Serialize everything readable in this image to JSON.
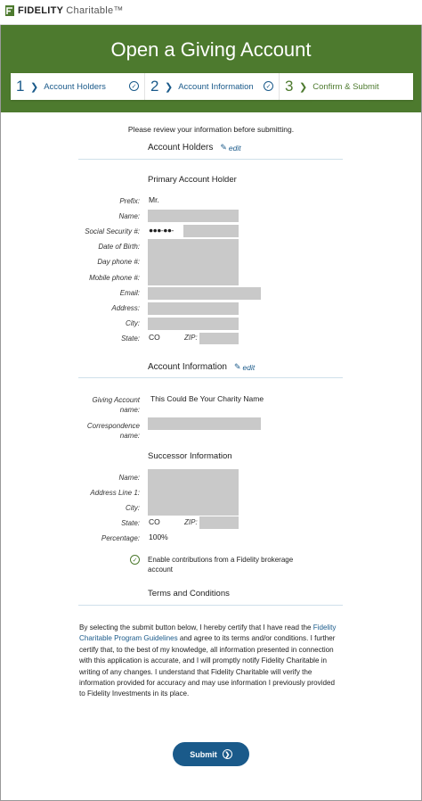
{
  "brand": {
    "name_bold": "FIDELITY",
    "name_rest": "Charitable™"
  },
  "page": {
    "title": "Open a Giving Account"
  },
  "steps": [
    {
      "num": "1",
      "label": "Account Holders",
      "complete": true
    },
    {
      "num": "2",
      "label": "Account Information",
      "complete": true
    },
    {
      "num": "3",
      "label": "Confirm & Submit",
      "complete": false
    }
  ],
  "review_note": "Please review your information before submitting.",
  "account_holders": {
    "heading": "Account Holders",
    "edit_label": "edit",
    "primary_heading": "Primary Account Holder",
    "labels": {
      "prefix": "Prefix:",
      "name": "Name:",
      "ssn": "Social Security #:",
      "dob": "Date of Birth:",
      "day_phone": "Day phone #:",
      "mobile_phone": "Mobile phone #:",
      "email": "Email:",
      "address": "Address:",
      "city": "City:",
      "state": "State:",
      "zip": "ZIP:"
    },
    "values": {
      "prefix": "Mr.",
      "ssn_mask": "●●●-●●-",
      "state": "CO"
    }
  },
  "account_information": {
    "heading": "Account Information",
    "edit_label": "edit",
    "labels": {
      "giving_name_1": "Giving Account",
      "giving_name_2": "name:",
      "correspondence_1": "Correspondence",
      "correspondence_2": "name:"
    },
    "values": {
      "giving_name": "This Could Be Your Charity Name"
    }
  },
  "successor": {
    "heading": "Successor Information",
    "labels": {
      "name": "Name:",
      "address1": "Address Line 1:",
      "city": "City:",
      "state": "State:",
      "zip": "ZIP:",
      "percentage": "Percentage:"
    },
    "values": {
      "state": "CO",
      "percentage": "100%"
    }
  },
  "brokerage_option": {
    "text": "Enable contributions from a Fidelity brokerage account",
    "checked": true
  },
  "terms": {
    "heading": "Terms and Conditions",
    "intro": "By selecting the submit button below, I hereby certify that I have read the ",
    "link": "Fidelity Charitable Program Guidelines",
    "rest": " and agree to its terms and/or conditions. I further certify that, to the best of my knowledge, all information presented in connection with this application is accurate, and I will promptly notify Fidelity Charitable in writing of any changes. I understand that Fidelity Charitable will verify the information provided for accuracy and may use information I previously provided to Fidelity Investments in its place."
  },
  "submit": {
    "label": "Submit"
  },
  "colors": {
    "brand_green": "#4d7a2e",
    "link_blue": "#1a5a8a",
    "redaction_gray": "#c9c9c9"
  }
}
